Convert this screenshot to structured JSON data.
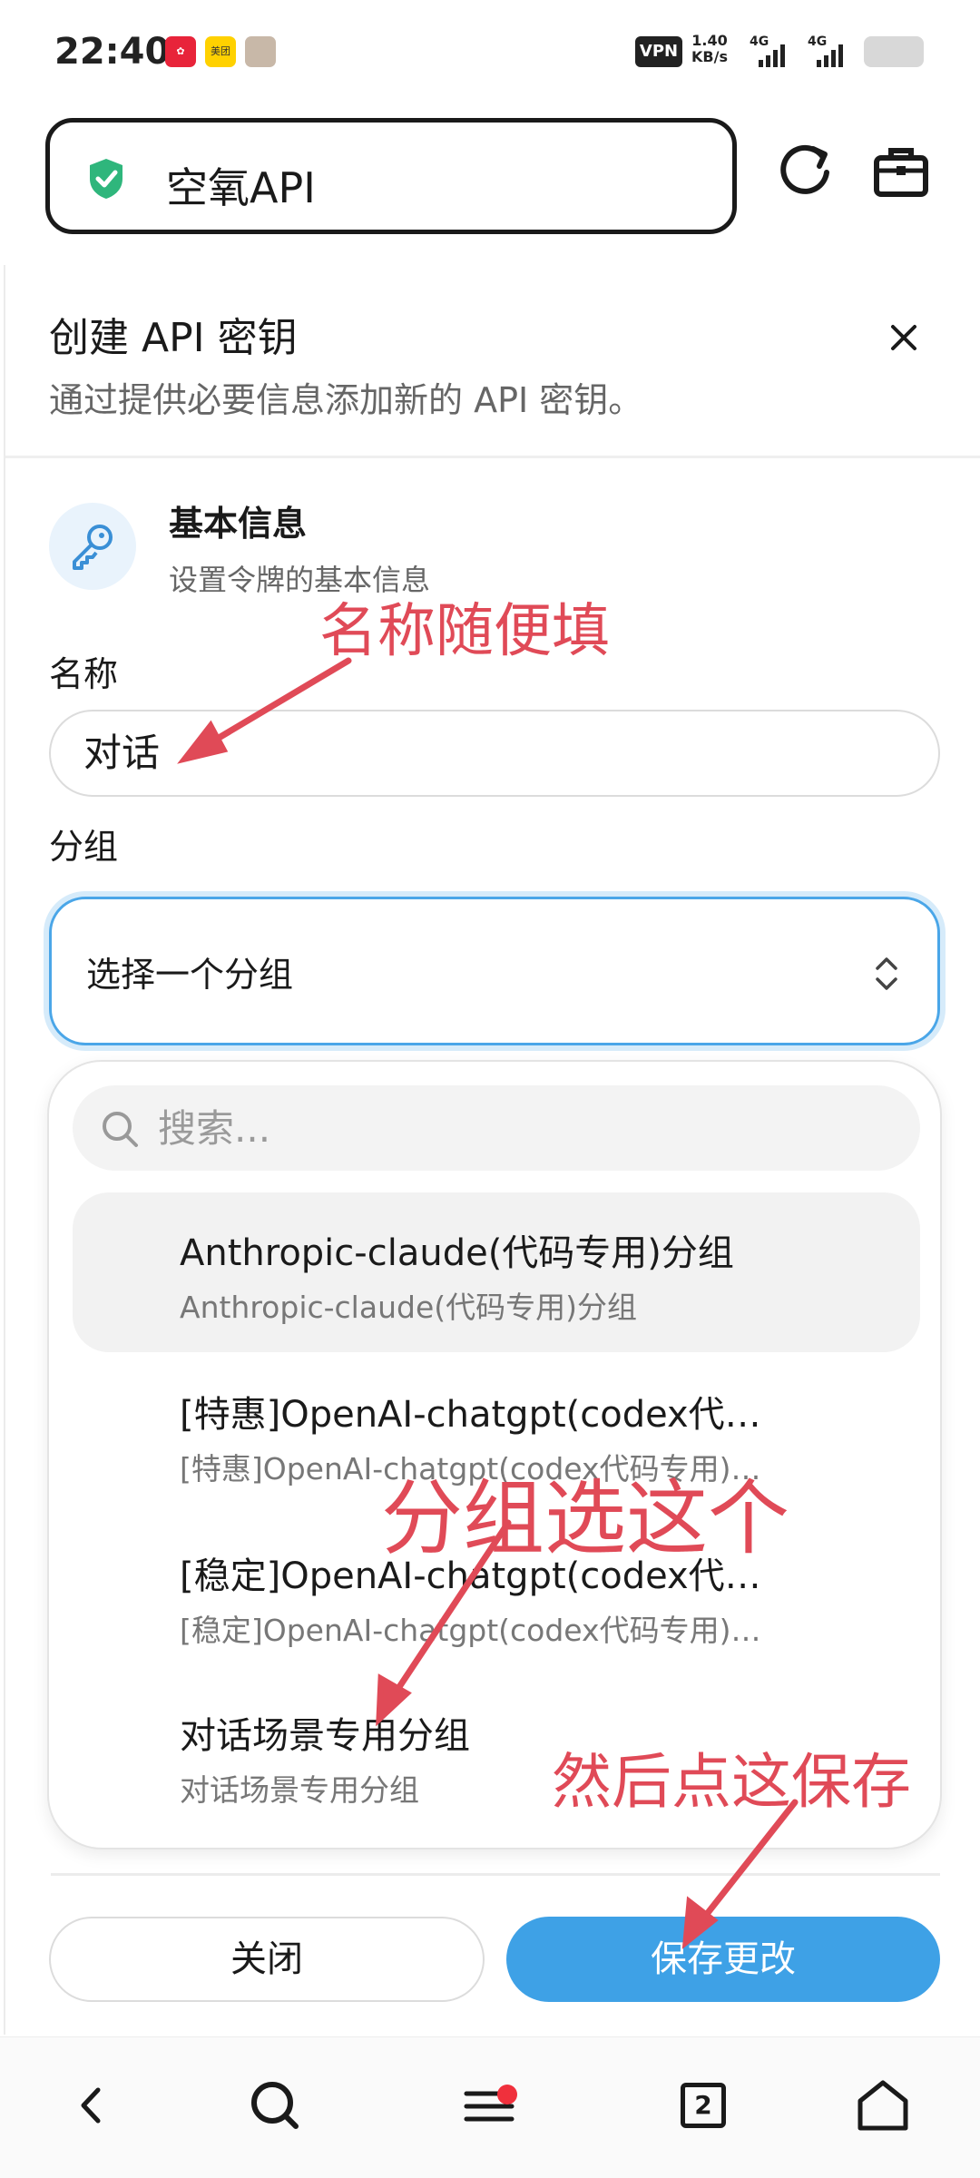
{
  "status_bar": {
    "time": "22:40",
    "vpn": "VPN",
    "speed_value": "1.40",
    "speed_unit": "KB/s",
    "net1": "4G",
    "net2": "4G",
    "app_icons": [
      "pinduoduo-icon",
      "meituan-icon",
      "photo-icon"
    ],
    "meituan_text": "美团"
  },
  "browser": {
    "url_title": "空氧API",
    "icons": [
      "shield-check-icon",
      "reload-icon",
      "toolbox-icon"
    ]
  },
  "dialog": {
    "title": "创建 API 密钥",
    "subtitle": "通过提供必要信息添加新的 API 密钥。",
    "section": {
      "title": "基本信息",
      "subtitle": "设置令牌的基本信息"
    },
    "name_label": "名称",
    "name_value": "对话",
    "group_label": "分组",
    "group_placeholder": "选择一个分组",
    "search_placeholder": "搜索...",
    "options": [
      {
        "title": "Anthropic-claude(代码专用)分组",
        "subtitle": "Anthropic-claude(代码专用)分组"
      },
      {
        "title": "[特惠]OpenAI-chatgpt(codex代…",
        "subtitle": "[特惠]OpenAI-chatgpt(codex代码专用)…"
      },
      {
        "title": "[稳定]OpenAI-chatgpt(codex代…",
        "subtitle": "[稳定]OpenAI-chatgpt(codex代码专用)…"
      },
      {
        "title": "对话场景专用分组",
        "subtitle": "对话场景专用分组"
      }
    ],
    "close_button": "关闭",
    "save_button": "保存更改"
  },
  "annotations": {
    "name_hint": "名称随便填",
    "group_hint": "分组选这个",
    "save_hint": "然后点这保存"
  },
  "bottom_nav": {
    "tab_count": "2",
    "icons": [
      "back-icon",
      "search-icon",
      "menu-icon",
      "tabs-icon",
      "home-icon"
    ]
  },
  "colors": {
    "accent": "#3ea1e6",
    "annotation": "#e04a57",
    "shield": "#2fb67c"
  }
}
